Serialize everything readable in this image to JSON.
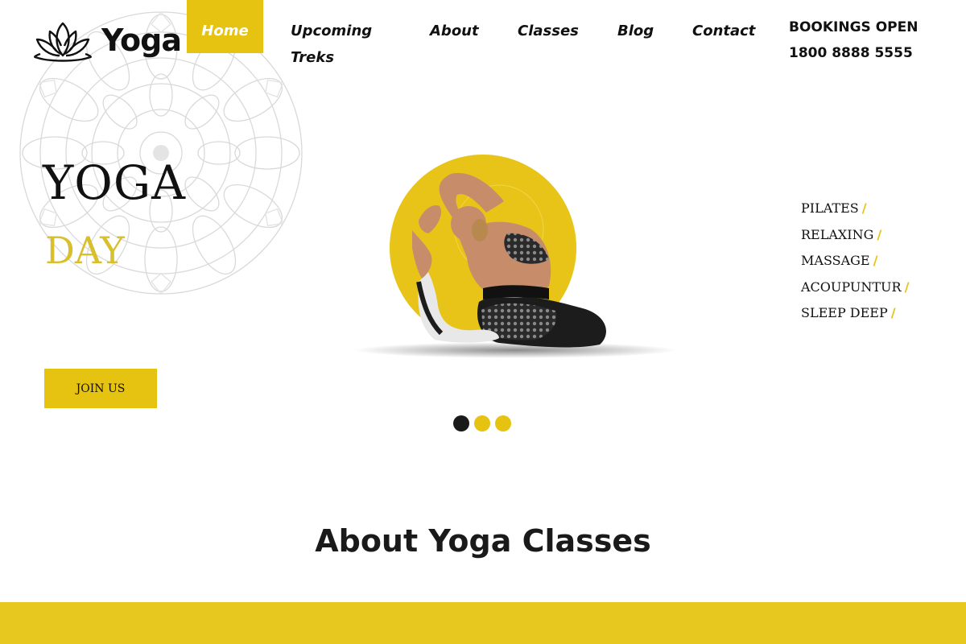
{
  "brand": {
    "name": "Yoga",
    "logo_icon": "lotus-icon",
    "accent_color": "#e6c211"
  },
  "nav": {
    "items": [
      {
        "label": "Home",
        "active": true
      },
      {
        "label": "Upcoming Treks",
        "active": false
      },
      {
        "label": "About",
        "active": false
      },
      {
        "label": "Classes",
        "active": false
      },
      {
        "label": "Blog",
        "active": false
      },
      {
        "label": "Contact",
        "active": false
      }
    ]
  },
  "bookings": {
    "label": "BOOKINGS OPEN",
    "phone": "1800 8888 5555"
  },
  "hero": {
    "title_line1": "YOGA",
    "title_line2": "DAY",
    "cta_label": "JOIN US",
    "image_icon": "yoga-pose-illustration",
    "background_icon": "mandala-icon",
    "services": [
      "PILATES",
      "RELAXING",
      "MASSAGE",
      "ACOUPUNTUR",
      "SLEEP DEEP"
    ],
    "service_separator": "/"
  },
  "slider": {
    "dot_count": 3,
    "active_index": 0
  },
  "about": {
    "heading": "About Yoga Classes"
  }
}
